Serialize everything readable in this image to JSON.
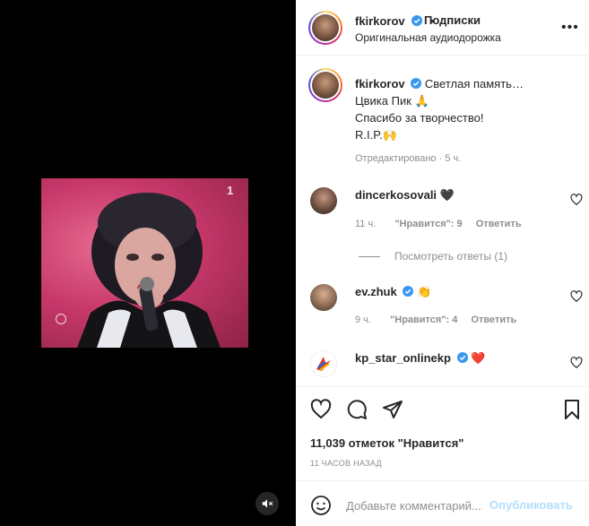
{
  "media": {
    "channel_logo": "1",
    "mute_icon": "muted-speaker-icon"
  },
  "header": {
    "username": "fkirkorov",
    "separator": "•",
    "follow_label": "Подписки",
    "audio_label": "Оригинальная аудиодорожка",
    "more_label": "•••"
  },
  "caption": {
    "username": "fkirkorov",
    "lines": [
      "Светлая память…",
      "Цвика Пик 🙏",
      "Спасибо за творчество!",
      "R.I.P.🙌"
    ],
    "meta": "Отредактировано · 5 ч."
  },
  "comments": [
    {
      "username": "dincerkosovali",
      "text": "🖤",
      "time": "11 ч.",
      "likes": "\"Нравится\": 9",
      "reply": "Ответить"
    },
    {
      "username": "ev.zhuk",
      "text": "👏",
      "time": "9 ч.",
      "likes": "\"Нравится\": 4",
      "reply": "Ответить"
    },
    {
      "username": "kp_star_onlinekp",
      "text": "❤️"
    }
  ],
  "view_replies": "Посмотреть ответы (1)",
  "likes_text": "11,039 отметок \"Нравится\"",
  "time_ago": "11 ЧАСОВ НАЗАД",
  "comment_bar": {
    "placeholder": "Добавьте комментарий...",
    "publish": "Опубликовать"
  },
  "colors": {
    "accent": "#0095f6",
    "publish_disabled": "#b2dffc",
    "verified": "#3897f0"
  }
}
